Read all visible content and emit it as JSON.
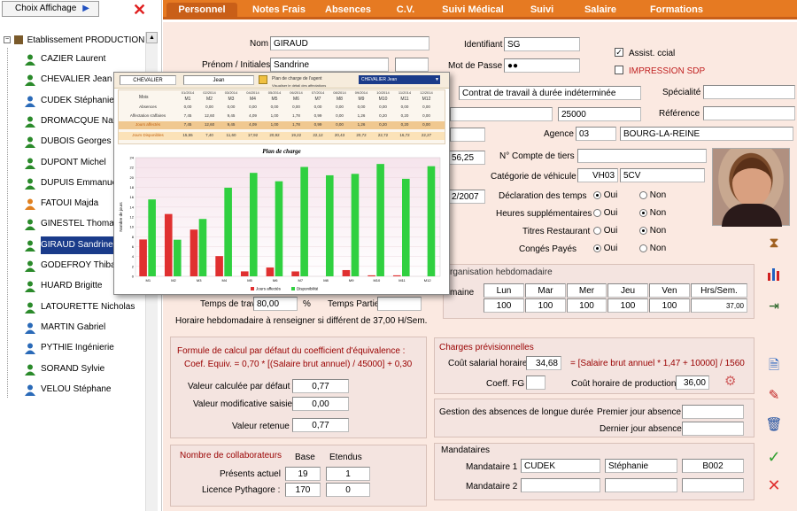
{
  "left": {
    "choix_affichage": "Choix Affichage",
    "tree_root": "Etablissement PRODUCTION",
    "employees": [
      "CAZIER Laurent",
      "CHEVALIER Jean",
      "CUDEK Stéphanie",
      "DROMACQUE Nath",
      "DUBOIS Georges",
      "DUPONT Michel",
      "DUPUIS Emmanuel",
      "FATOUI Majda",
      "GINESTEL Thomas",
      "GIRAUD Sandrine",
      "GODEFROY Thibau",
      "HUARD Brigitte",
      "LATOURETTE Nicholas",
      "MARTIN Gabriel",
      "PYTHIE Ingénierie",
      "SORAND Sylvie",
      "VELOU Stéphane"
    ],
    "employee_colors": [
      "#2a8a2a",
      "#2a8a2a",
      "#2a6ab8",
      "#2a8a2a",
      "#2a8a2a",
      "#2a8a2a",
      "#2a8a2a",
      "#e08020",
      "#2a8a2a",
      "#2a8a2a",
      "#2a8a2a",
      "#2a8a2a",
      "#2a8a2a",
      "#2a6ab8",
      "#2a6ab8",
      "#2a8a2a",
      "#2a6ab8"
    ],
    "selected_index": 9
  },
  "tabs": [
    "Personnel",
    "Notes Frais",
    "Absences",
    "C.V.",
    "Suivi Médical",
    "Suivi",
    "Salaire",
    "Formations"
  ],
  "form": {
    "nom_label": "Nom",
    "nom": "GIRAUD",
    "prenom_label": "Prénom / Initiales",
    "prenom": "Sandrine",
    "identifiant_label": "Identifiant",
    "identifiant": "SG",
    "mdp_label": "Mot de Passe",
    "mdp": "●●",
    "assist_label": "Assist. ccial",
    "impression_label": "IMPRESSION SDP",
    "contrat": "Contrat de travail à durée indéterminée",
    "specialite_label": "Spécialité",
    "salaire": "25000",
    "reference_label": "Référence",
    "agence_label": "Agence",
    "agence_code": "03",
    "agence_name": "BOURG-LA-REINE",
    "partial_5625": "56,25",
    "compte_tiers_label": "N° Compte de tiers",
    "categorie_label": "Catégorie de véhicule",
    "categorie_code": "VH03",
    "categorie_val": "5CV",
    "date_partial": "2/2007",
    "decl_temps_label": "Déclaration des temps",
    "heures_sup_label": "Heures supplémentaires",
    "titres_label": "Titres Restaurant",
    "conges_label": "Congés Payés",
    "oui": "Oui",
    "non": "Non",
    "org_hebdo": "rganisation hebdomadaire",
    "semaine_partial": "maine",
    "days": [
      "Lun",
      "Mar",
      "Mer",
      "Jeu",
      "Ven",
      "Hrs/Sem."
    ],
    "day_values": [
      "100",
      "100",
      "100",
      "100",
      "100",
      "37,00"
    ],
    "temps_travail_label": "Temps de travail",
    "temps_travail": "80,00",
    "pct": "%",
    "temps_partiel_label": "Temps Partiel",
    "horaire_text": "Horaire hebdomadaire à renseigner si différent de 37,00 H/Sem.",
    "formule_l1": "Formule de calcul par défaut du coefficient d'équivalence :",
    "formule_l2": "Coef. Equiv. = 0,70 * [(Salaire brut annuel) / 45000] + 0,30",
    "val_calc_label": "Valeur calculée par défaut",
    "val_calc": "0,77",
    "val_modif_label": "Valeur modificative saisie",
    "val_modif": "0,00",
    "val_ret_label": "Valeur retenue",
    "val_ret": "0,77",
    "nb_collab": "Nombre de collaborateurs",
    "base": "Base",
    "etendus": "Etendus",
    "presents_label": "Présents actuel",
    "presents_base": "19",
    "presents_et": "1",
    "licence_label": "Licence Pythagore :",
    "licence_base": "170",
    "licence_et": "0",
    "charges_title": "Charges prévisionnelles",
    "cout_sal_label": "Coût salarial horaire",
    "cout_sal": "34,68",
    "cout_formula": "= [Salaire brut annuel * 1,47 + 10000] / 1560",
    "coeff_fg_label": "Coeff. FG",
    "cout_prod_label": "Coût horaire de production",
    "cout_prod": "36,00",
    "absences_label": "Gestion des absences de longue durée",
    "premier_label": "Premier jour absence",
    "dernier_label": "Dernier jour absence",
    "mandataires_title": "Mandataires",
    "mand1_label": "Mandataire 1",
    "mand1_nom": "CUDEK",
    "mand1_prenom": "Stéphanie",
    "mand1_code": "B002",
    "mand2_label": "Mandataire 2"
  },
  "popup": {
    "f1": "CHEVALIER",
    "f2": "Jean",
    "plan_label": "Plan de charge de l'agent",
    "plan_value": "CHEVALIER Jean",
    "visualiser": "Visualiser le détail des affectations",
    "mois_label": "Mois",
    "months": [
      "01/2014",
      "02/2014",
      "03/2014",
      "04/2014",
      "05/2014",
      "06/2014",
      "07/2014",
      "08/2014",
      "09/2014",
      "10/2014",
      "11/2014",
      "12/2014"
    ],
    "mcodes": [
      "M1",
      "M2",
      "M3",
      "M4",
      "M5",
      "M6",
      "M7",
      "M8",
      "M9",
      "M10",
      "M11",
      "M12"
    ],
    "rows": [
      {
        "label": "Absences",
        "vals": [
          "0,00",
          "0,00",
          "0,00",
          "0,00",
          "0,00",
          "0,00",
          "0,00",
          "0,00",
          "0,00",
          "0,00",
          "0,00",
          "0,00"
        ]
      },
      {
        "label": "Affectation s'affaires",
        "vals": [
          "7,45",
          "12,60",
          "9,45",
          "4,09",
          "1,00",
          "1,78",
          "0,99",
          "0,00",
          "1,26",
          "0,20",
          "0,20",
          "0,00"
        ]
      },
      {
        "label": "Jours affectés",
        "vals": [
          "7,45",
          "12,60",
          "9,45",
          "4,09",
          "1,00",
          "1,78",
          "0,99",
          "0,00",
          "1,26",
          "0,20",
          "0,20",
          "0,00"
        ]
      },
      {
        "label": "Jours Disponibles",
        "vals": [
          "15,55",
          "7,40",
          "11,60",
          "17,92",
          "20,92",
          "19,22",
          "22,12",
          "20,43",
          "20,72",
          "22,72",
          "16,72",
          "22,27"
        ]
      }
    ],
    "chart_title": "Plan de charge",
    "ylabel": "Nombre de jours",
    "legend_affectes": "Jours affectés",
    "legend_dispo": "Disponibilité"
  },
  "chart_data": {
    "type": "bar",
    "title": "Plan de charge",
    "ylabel": "Nombre de jours",
    "categories": [
      "M1",
      "M2",
      "M3",
      "M4",
      "M5",
      "M6",
      "M7",
      "M8",
      "M9",
      "M10",
      "M11",
      "M12"
    ],
    "ylim": [
      0,
      24
    ],
    "yticks": [
      0,
      2,
      4,
      6,
      8,
      10,
      12,
      14,
      16,
      18,
      20,
      22,
      24
    ],
    "series": [
      {
        "name": "Jours affectés",
        "color": "#e03030",
        "values": [
          7.45,
          12.6,
          9.45,
          4.09,
          1.0,
          1.78,
          0.99,
          0.0,
          1.26,
          0.2,
          0.2,
          0.0
        ]
      },
      {
        "name": "Disponibilité",
        "color": "#30d040",
        "values": [
          15.55,
          7.4,
          11.6,
          17.92,
          20.92,
          19.22,
          22.12,
          20.43,
          20.72,
          22.72,
          19.72,
          22.27
        ]
      }
    ]
  }
}
